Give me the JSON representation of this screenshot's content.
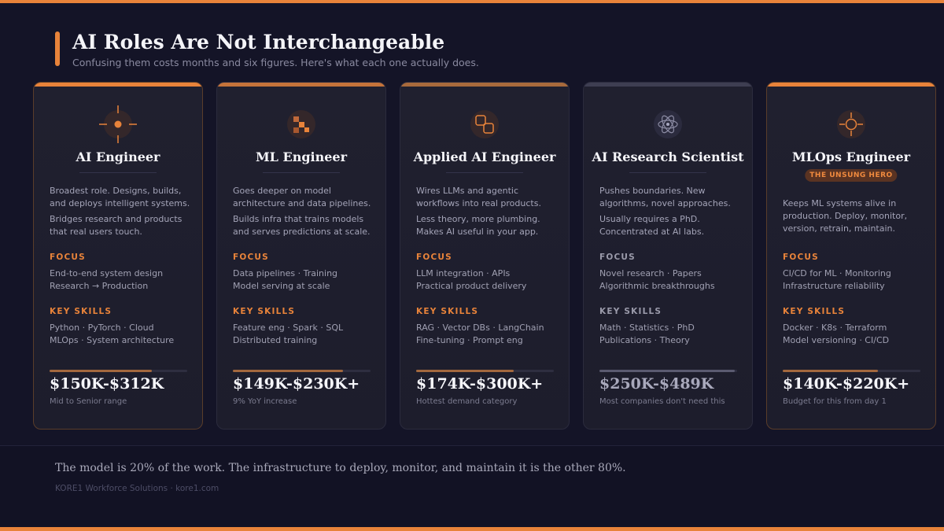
{
  "header": {
    "title": "AI Roles Are Not Interchangeable",
    "subtitle": "Confusing them costs months and six figures. Here's what each one actually does."
  },
  "colors": {
    "accent": "#e8833a",
    "background": "#141427",
    "card": "#1f1f2e"
  },
  "cards": [
    {
      "title": "AI Engineer",
      "icon": "crosshair-icon",
      "desc1": "Broadest role. Designs, builds, and deploys intelligent systems.",
      "desc2": "Bridges research and products that real users touch.",
      "focus_label": "FOCUS",
      "focus_1": "End-to-end system design",
      "focus_2": "Research → Production",
      "skills_label": "KEY SKILLS",
      "skills_1": "Python · PyTorch · Cloud",
      "skills_2": "MLOps · System architecture",
      "salary": "$150K-$312K",
      "note": "Mid to Senior range",
      "bar_fraction": 0.74
    },
    {
      "title": "ML Engineer",
      "icon": "blocks-icon",
      "desc1": "Goes deeper on model architecture and data pipelines.",
      "desc2": "Builds infra that trains models and serves predictions at scale.",
      "focus_label": "FOCUS",
      "focus_1": "Data pipelines · Training",
      "focus_2": "Model serving at scale",
      "skills_label": "KEY SKILLS",
      "skills_1": "Feature eng · Spark · SQL",
      "skills_2": "Distributed training",
      "salary": "$149K-$230K+",
      "note": "9% YoY increase",
      "bar_fraction": 0.8
    },
    {
      "title": "Applied AI Engineer",
      "icon": "connected-squares-icon",
      "desc1": "Wires LLMs and agentic workflows into real products.",
      "desc2": "Less theory, more plumbing. Makes AI useful in your app.",
      "focus_label": "FOCUS",
      "focus_1": "LLM integration · APIs",
      "focus_2": "Practical product delivery",
      "skills_label": "KEY SKILLS",
      "skills_1": "RAG · Vector DBs · LangChain",
      "skills_2": "Fine-tuning · Prompt eng",
      "salary": "$174K-$300K+",
      "note": "Hottest demand category",
      "bar_fraction": 0.71
    },
    {
      "title": "AI Research Scientist",
      "icon": "atom-icon",
      "desc1": "Pushes boundaries. New algorithms, novel approaches.",
      "desc2": "Usually requires a PhD. Concentrated at AI labs.",
      "focus_label": "FOCUS",
      "focus_1": "Novel research · Papers",
      "focus_2": "Algorithmic breakthroughs",
      "skills_label": "KEY SKILLS",
      "skills_1": "Math · Statistics · PhD",
      "skills_2": "Publications · Theory",
      "salary": "$250K-$489K",
      "note": "Most companies don't need this",
      "bar_fraction": 0.98
    },
    {
      "title": "MLOps Engineer",
      "icon": "target-icon",
      "badge": "THE UNSUNG HERO",
      "desc1": "Keeps ML systems alive in production. Deploy, monitor, version, retrain, maintain.",
      "focus_label": "FOCUS",
      "focus_1": "CI/CD for ML · Monitoring",
      "focus_2": "Infrastructure reliability",
      "skills_label": "KEY SKILLS",
      "skills_1": "Docker · K8s · Terraform",
      "skills_2": "Model versioning · CI/CD",
      "salary": "$140K-$220K+",
      "note": "Budget for this from day 1",
      "bar_fraction": 0.69
    }
  ],
  "footer": {
    "quote": "The model is 20% of the work. The infrastructure to deploy, monitor, and maintain it is the other 80%.",
    "credit": "KORE1 Workforce Solutions · kore1.com"
  }
}
